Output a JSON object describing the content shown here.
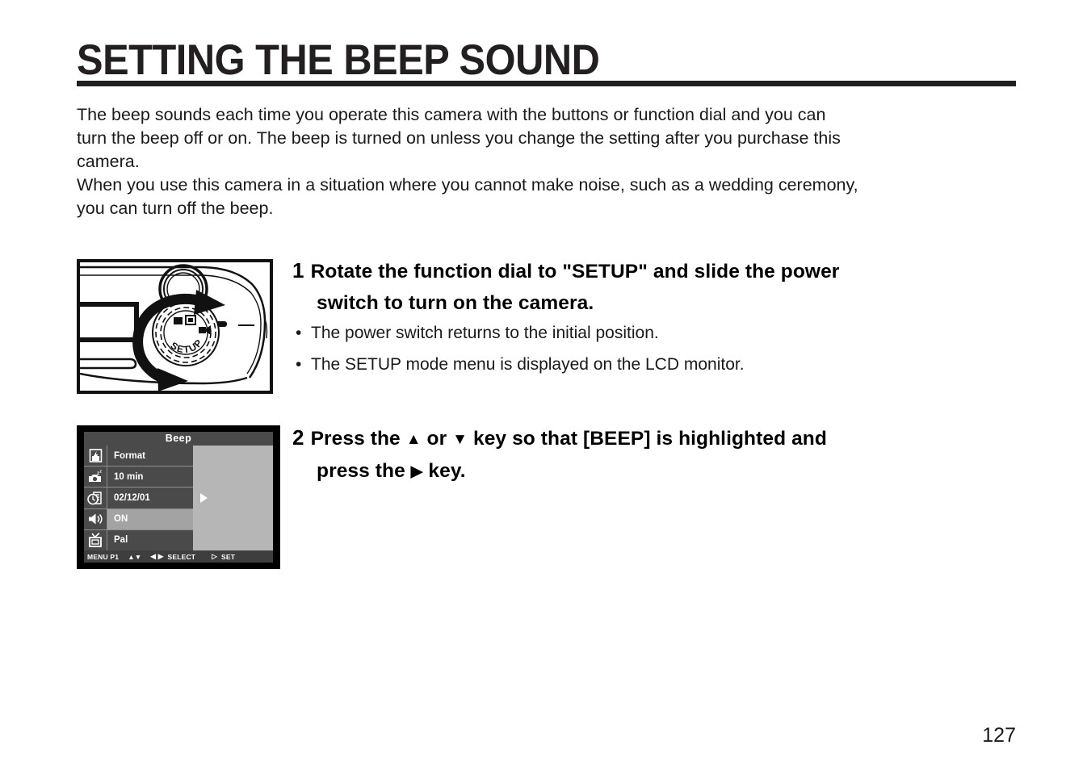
{
  "page": {
    "title": "SETTING THE BEEP SOUND",
    "number": "127"
  },
  "intro": {
    "line1": "The beep sounds each time you operate this camera with the buttons or function dial and you can",
    "line2": "turn the beep off or on. The beep is turned on unless you change the setting after you purchase this",
    "line3": "camera.",
    "line4": "When you use this camera in a situation where you cannot make noise, such as a wedding ceremony,",
    "line5": "you can turn off the beep."
  },
  "steps": [
    {
      "number": "1",
      "heading_line1": "Rotate the function dial to \"SETUP\" and slide the power",
      "heading_line2": "switch to turn on the camera.",
      "bullets": [
        "The power switch returns to the initial position.",
        "The SETUP mode menu is displayed on the LCD monitor."
      ]
    },
    {
      "number": "2",
      "heading_part1": "Press the",
      "heading_up": "▲",
      "heading_or": "or",
      "heading_down": "▼",
      "heading_part2": "key so that [BEEP] is highlighted and",
      "heading_line2_part1": "press the",
      "heading_right": "▶",
      "heading_line2_part2": "key."
    }
  ],
  "camera_figure": {
    "dial_label": "SETUP",
    "icon_names": [
      "camera-mode-icon",
      "playback-mode-icon",
      "movie-mode-icon",
      "rotate-dial-arrow-icon",
      "power-switch-arrow-icon"
    ]
  },
  "lcd": {
    "title": "Beep",
    "rows": [
      {
        "icon": "format-card-icon",
        "label": "Format",
        "selected": false
      },
      {
        "icon": "auto-power-off-icon",
        "label": "10 min",
        "selected": false
      },
      {
        "icon": "date-clock-icon",
        "label": "02/12/01",
        "selected": false
      },
      {
        "icon": "beep-speaker-icon",
        "label": "ON",
        "selected": true
      },
      {
        "icon": "video-out-tv-icon",
        "label": "Pal",
        "selected": false
      }
    ],
    "footer": {
      "menu": "MENU P1",
      "updown": "▲▼",
      "leftright": "◀ ▶",
      "select": "SELECT",
      "set_arrow": "▷",
      "set": "SET"
    }
  },
  "colors": {
    "title_rule": "#231f20",
    "lcd_panel": "#b6b6b6",
    "lcd_row": "#4a4a4a",
    "lcd_highlight": "#a3a3a3",
    "text": "#1a1a1a"
  }
}
